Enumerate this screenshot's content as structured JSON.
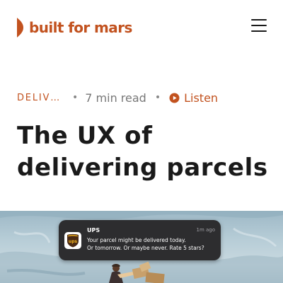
{
  "header": {
    "logo_text": "built for mars",
    "brand_color": "#c2521f",
    "menu_icon": "hamburger-menu-icon"
  },
  "article": {
    "category": "DELIVERY",
    "read_time": "7 min read",
    "separator": "•",
    "listen_label": "Listen",
    "listen_icon": "play-circle-icon",
    "title_line1": "The UX of",
    "title_line2": "delivering parcels"
  },
  "hero": {
    "notification": {
      "app": "UPS",
      "time": "1m ago",
      "line1": "Your parcel might be delivered today.",
      "line2": "Or tomorrow. Or maybe never. Rate 5 stars?",
      "icon": "ups-logo-icon"
    }
  }
}
